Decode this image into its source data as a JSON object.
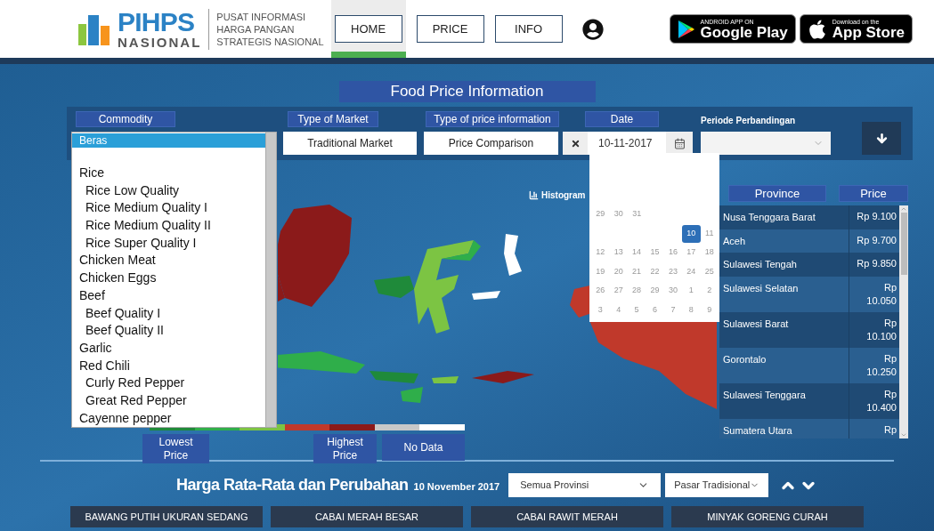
{
  "header": {
    "logo": {
      "word": "PIHPS",
      "subword": "NASIONAL"
    },
    "tagline": [
      "PUSAT INFORMASI",
      "HARGA PANGAN",
      "STRATEGIS NASIONAL"
    ],
    "nav": [
      {
        "label": "HOME",
        "selected": true
      },
      {
        "label": "PRICE",
        "selected": false
      },
      {
        "label": "INFO",
        "selected": false
      }
    ],
    "stores": [
      {
        "kind": "google",
        "small": "ANDROID APP ON",
        "big": "Google Play"
      },
      {
        "kind": "apple",
        "small": "Download on the",
        "big": "App Store"
      }
    ]
  },
  "title": "Food Price Information",
  "filters": {
    "commodity": {
      "label": "Commodity",
      "options": [
        {
          "label": "Beras",
          "selected": true
        },
        {
          "label": "Rice",
          "selected": false,
          "children": [
            {
              "label": "Rice Low Quality",
              "selected": false
            },
            {
              "label": "Rice Medium Quality I",
              "selected": false
            },
            {
              "label": "Rice Medium Quality II",
              "selected": false
            },
            {
              "label": "Rice Super Quality I",
              "selected": false
            }
          ]
        },
        {
          "label": "Chicken Meat",
          "selected": false
        },
        {
          "label": "Chicken Eggs",
          "selected": false
        },
        {
          "label": "Beef",
          "selected": false,
          "children": [
            {
              "label": "Beef Quality I",
              "selected": false
            },
            {
              "label": "Beef Quality II",
              "selected": false
            }
          ]
        },
        {
          "label": "Garlic",
          "selected": false
        },
        {
          "label": "Red Chili",
          "selected": false,
          "children": [
            {
              "label": "Curly Red Pepper",
              "selected": false
            },
            {
              "label": "Great Red Pepper",
              "selected": false
            }
          ]
        },
        {
          "label": "Cayenne pepper",
          "selected": false
        }
      ]
    },
    "market": {
      "label": "Type of Market",
      "value": "Traditional Market"
    },
    "price_info": {
      "label": "Type of price information",
      "value": "Price Comparison"
    },
    "date": {
      "label": "Date",
      "value": "10-11-2017"
    },
    "period": {
      "label": "Periode Perbandingan"
    }
  },
  "calendar": {
    "weeks": [
      {
        "kind": "start",
        "days": [
          {
            "day": "29",
            "selected": false
          },
          {
            "day": "30",
            "selected": false
          },
          {
            "day": "31",
            "selected": false
          }
        ]
      },
      {
        "kind": "end",
        "days": [
          {
            "day": "10",
            "selected": true
          },
          {
            "day": "11",
            "selected": false
          }
        ]
      },
      {
        "kind": "full",
        "days": [
          {
            "day": "12",
            "selected": false
          },
          {
            "day": "13",
            "selected": false
          },
          {
            "day": "14",
            "selected": false
          },
          {
            "day": "15",
            "selected": false
          },
          {
            "day": "16",
            "selected": false
          },
          {
            "day": "17",
            "selected": false
          },
          {
            "day": "18",
            "selected": false
          }
        ]
      },
      {
        "kind": "full",
        "days": [
          {
            "day": "19",
            "selected": false
          },
          {
            "day": "20",
            "selected": false
          },
          {
            "day": "21",
            "selected": false
          },
          {
            "day": "22",
            "selected": false
          },
          {
            "day": "23",
            "selected": false
          },
          {
            "day": "24",
            "selected": false
          },
          {
            "day": "25",
            "selected": false
          }
        ]
      },
      {
        "kind": "full",
        "days": [
          {
            "day": "26",
            "selected": false
          },
          {
            "day": "27",
            "selected": false
          },
          {
            "day": "28",
            "selected": false
          },
          {
            "day": "29",
            "selected": false
          },
          {
            "day": "30",
            "selected": false
          },
          {
            "day": "1",
            "selected": false
          },
          {
            "day": "2",
            "selected": false
          }
        ]
      },
      {
        "kind": "full",
        "days": [
          {
            "day": "3",
            "selected": false
          },
          {
            "day": "4",
            "selected": false
          },
          {
            "day": "5",
            "selected": false
          },
          {
            "day": "6",
            "selected": false
          },
          {
            "day": "7",
            "selected": false
          },
          {
            "day": "8",
            "selected": false
          },
          {
            "day": "9",
            "selected": false
          }
        ]
      }
    ]
  },
  "map": {
    "histogram_link": "Histogram",
    "legend": {
      "swatches": [
        {
          "color": "#1f8a3a"
        },
        {
          "color": "#2fae4a"
        },
        {
          "color": "#7cc443"
        },
        {
          "color": "#c0392b"
        },
        {
          "color": "#8b1a1a"
        },
        {
          "color": "#c8c8c8"
        },
        {
          "color": "#ffffff"
        }
      ],
      "labels": [
        {
          "kind": "low",
          "text": "Lowest Price"
        },
        {
          "kind": "high",
          "text": "Highest Price"
        },
        {
          "kind": "nodata",
          "text": "No Data"
        }
      ]
    }
  },
  "table": {
    "columns": [
      "Province",
      "Price"
    ],
    "rows": [
      {
        "province": "Nusa Tenggara Barat",
        "price": "Rp 9.100"
      },
      {
        "province": "Aceh",
        "price": "Rp 9.700"
      },
      {
        "province": "Sulawesi Tengah",
        "price": "Rp 9.850"
      },
      {
        "province": "Sulawesi Selatan",
        "price": "Rp 10.050"
      },
      {
        "province": "Sulawesi Barat",
        "price": "Rp 10.100"
      },
      {
        "province": "Gorontalo",
        "price": "Rp 10.250"
      },
      {
        "province": "Sulawesi Tenggara",
        "price": "Rp 10.400"
      },
      {
        "province": "Sumatera Utara",
        "price": "Rp"
      }
    ]
  },
  "summary": {
    "heading": "Harga Rata-Rata dan Perubahan",
    "date": "10 November 2017",
    "province_select": "Semua Provinsi",
    "market_select": "Pasar Tradisional"
  },
  "commodity_tabs": [
    "BAWANG PUTIH UKURAN SEDANG",
    "CABAI MERAH BESAR",
    "CABAI RAWIT MERAH",
    "MINYAK GORENG CURAH"
  ]
}
